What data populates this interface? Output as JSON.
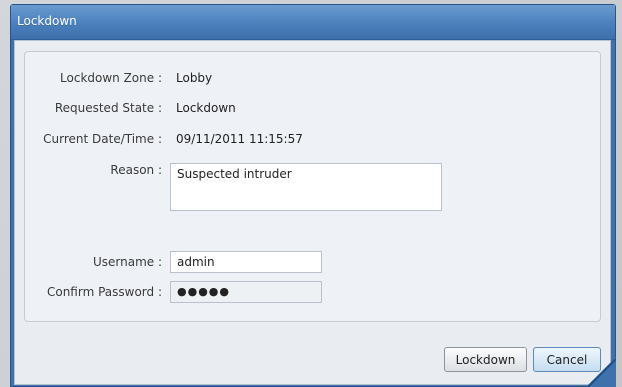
{
  "dialog": {
    "title": "Lockdown"
  },
  "form": {
    "zone_label": "Lockdown Zone :",
    "zone_value": "Lobby",
    "state_label": "Requested State :",
    "state_value": "Lockdown",
    "datetime_label": "Current Date/Time :",
    "datetime_value": "09/11/2011 11:15:57",
    "reason_label": "Reason :",
    "reason_value": "Suspected intruder",
    "username_label": "Username :",
    "username_value": "admin",
    "password_label": "Confirm Password :",
    "password_value": "●●●●●"
  },
  "buttons": {
    "lockdown_label": "Lockdown",
    "cancel_label": "Cancel"
  },
  "colors": {
    "titlebar": "#4b80bd",
    "client_background": "#e9edf2",
    "cancel_accent": "#c4dcf0"
  }
}
